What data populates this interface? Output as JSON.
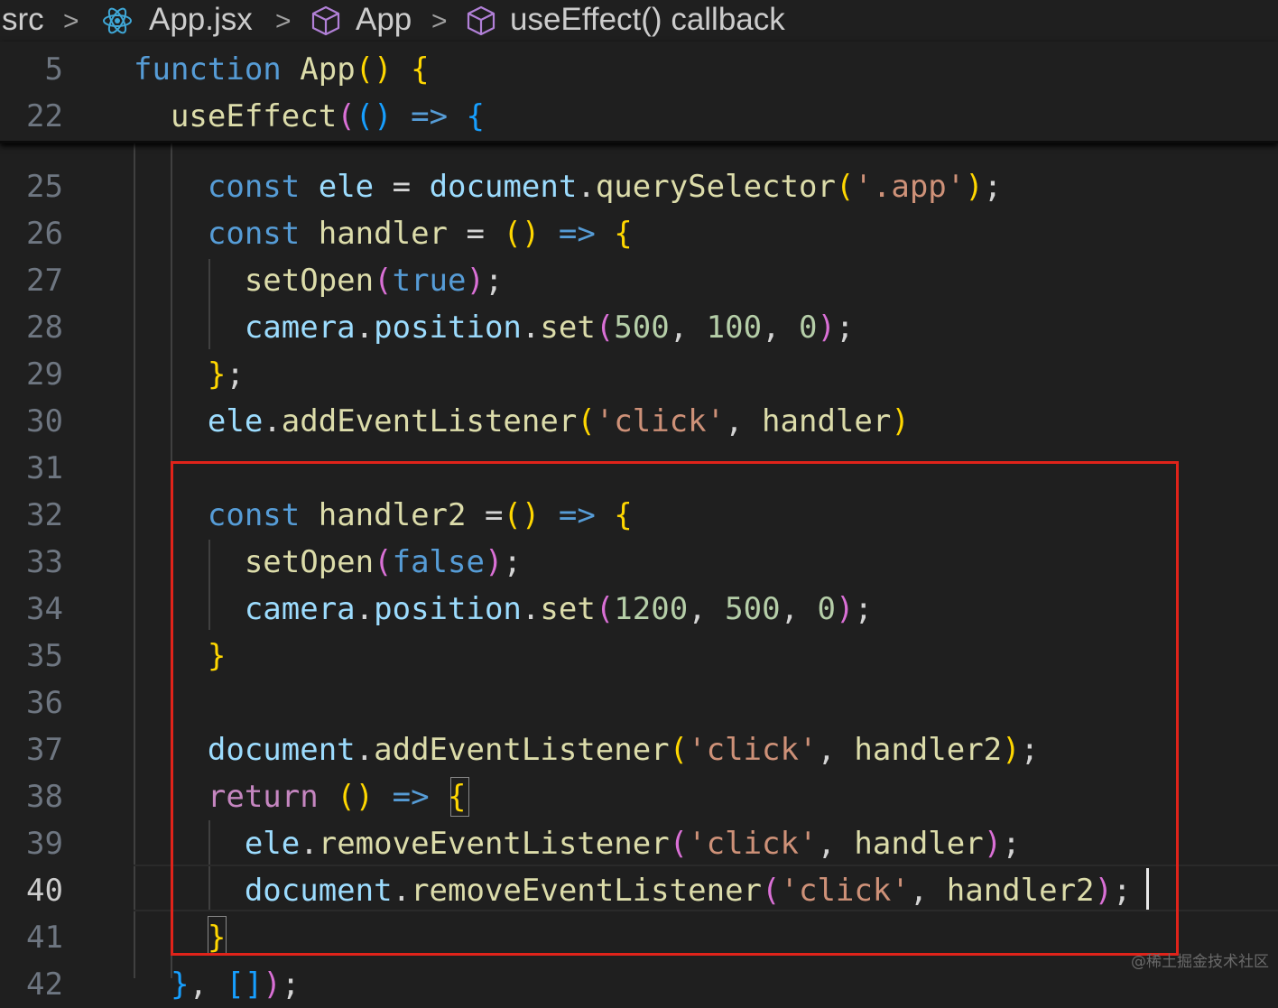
{
  "breadcrumb": {
    "items": [
      "src",
      "App.jsx",
      "App",
      "useEffect() callback"
    ],
    "separator": ">",
    "icons": [
      "react-icon",
      "cube-icon",
      "cube-icon"
    ]
  },
  "sticky_lines": [
    {
      "num": "5",
      "tokens": [
        {
          "t": "function",
          "c": "kw"
        },
        {
          "t": " ",
          "c": "pl"
        },
        {
          "t": "App",
          "c": "fn"
        },
        {
          "t": "()",
          "c": "b1"
        },
        {
          "t": " ",
          "c": "pl"
        },
        {
          "t": "{",
          "c": "b1"
        }
      ]
    },
    {
      "num": "22",
      "tokens": [
        {
          "t": "  ",
          "c": "pl"
        },
        {
          "t": "useEffect",
          "c": "fn"
        },
        {
          "t": "(",
          "c": "b2"
        },
        {
          "t": "()",
          "c": "b3"
        },
        {
          "t": " => ",
          "c": "kw"
        },
        {
          "t": "{",
          "c": "b3"
        }
      ]
    }
  ],
  "lines": [
    {
      "num": "25",
      "tokens": [
        {
          "t": "    ",
          "c": "pl"
        },
        {
          "t": "const",
          "c": "kw"
        },
        {
          "t": " ",
          "c": "pl"
        },
        {
          "t": "ele",
          "c": "var"
        },
        {
          "t": " = ",
          "c": "pl"
        },
        {
          "t": "document",
          "c": "var"
        },
        {
          "t": ".",
          "c": "pl"
        },
        {
          "t": "querySelector",
          "c": "fn"
        },
        {
          "t": "(",
          "c": "b1"
        },
        {
          "t": "'.app'",
          "c": "str"
        },
        {
          "t": ")",
          "c": "b1"
        },
        {
          "t": ";",
          "c": "pl"
        }
      ]
    },
    {
      "num": "26",
      "tokens": [
        {
          "t": "    ",
          "c": "pl"
        },
        {
          "t": "const",
          "c": "kw"
        },
        {
          "t": " ",
          "c": "pl"
        },
        {
          "t": "handler",
          "c": "fn"
        },
        {
          "t": " = ",
          "c": "pl"
        },
        {
          "t": "()",
          "c": "b1"
        },
        {
          "t": " => ",
          "c": "kw"
        },
        {
          "t": "{",
          "c": "b1"
        }
      ]
    },
    {
      "num": "27",
      "tokens": [
        {
          "t": "      ",
          "c": "pl"
        },
        {
          "t": "setOpen",
          "c": "fn"
        },
        {
          "t": "(",
          "c": "b2"
        },
        {
          "t": "true",
          "c": "kw"
        },
        {
          "t": ")",
          "c": "b2"
        },
        {
          "t": ";",
          "c": "pl"
        }
      ]
    },
    {
      "num": "28",
      "tokens": [
        {
          "t": "      ",
          "c": "pl"
        },
        {
          "t": "camera",
          "c": "var"
        },
        {
          "t": ".",
          "c": "pl"
        },
        {
          "t": "position",
          "c": "var"
        },
        {
          "t": ".",
          "c": "pl"
        },
        {
          "t": "set",
          "c": "fn"
        },
        {
          "t": "(",
          "c": "b2"
        },
        {
          "t": "500",
          "c": "num"
        },
        {
          "t": ", ",
          "c": "pl"
        },
        {
          "t": "100",
          "c": "num"
        },
        {
          "t": ", ",
          "c": "pl"
        },
        {
          "t": "0",
          "c": "num"
        },
        {
          "t": ")",
          "c": "b2"
        },
        {
          "t": ";",
          "c": "pl"
        }
      ]
    },
    {
      "num": "29",
      "tokens": [
        {
          "t": "    ",
          "c": "pl"
        },
        {
          "t": "}",
          "c": "b1"
        },
        {
          "t": ";",
          "c": "pl"
        }
      ]
    },
    {
      "num": "30",
      "tokens": [
        {
          "t": "    ",
          "c": "pl"
        },
        {
          "t": "ele",
          "c": "var"
        },
        {
          "t": ".",
          "c": "pl"
        },
        {
          "t": "addEventListener",
          "c": "fn"
        },
        {
          "t": "(",
          "c": "b1"
        },
        {
          "t": "'click'",
          "c": "str"
        },
        {
          "t": ", ",
          "c": "pl"
        },
        {
          "t": "handler",
          "c": "fn"
        },
        {
          "t": ")",
          "c": "b1"
        }
      ]
    },
    {
      "num": "31",
      "tokens": []
    },
    {
      "num": "32",
      "tokens": [
        {
          "t": "    ",
          "c": "pl"
        },
        {
          "t": "const",
          "c": "kw"
        },
        {
          "t": " ",
          "c": "pl"
        },
        {
          "t": "handler2",
          "c": "fn"
        },
        {
          "t": " =",
          "c": "pl"
        },
        {
          "t": "()",
          "c": "b1"
        },
        {
          "t": " => ",
          "c": "kw"
        },
        {
          "t": "{",
          "c": "b1"
        }
      ]
    },
    {
      "num": "33",
      "tokens": [
        {
          "t": "      ",
          "c": "pl"
        },
        {
          "t": "setOpen",
          "c": "fn"
        },
        {
          "t": "(",
          "c": "b2"
        },
        {
          "t": "false",
          "c": "kw"
        },
        {
          "t": ")",
          "c": "b2"
        },
        {
          "t": ";",
          "c": "pl"
        }
      ]
    },
    {
      "num": "34",
      "tokens": [
        {
          "t": "      ",
          "c": "pl"
        },
        {
          "t": "camera",
          "c": "var"
        },
        {
          "t": ".",
          "c": "pl"
        },
        {
          "t": "position",
          "c": "var"
        },
        {
          "t": ".",
          "c": "pl"
        },
        {
          "t": "set",
          "c": "fn"
        },
        {
          "t": "(",
          "c": "b2"
        },
        {
          "t": "1200",
          "c": "num"
        },
        {
          "t": ", ",
          "c": "pl"
        },
        {
          "t": "500",
          "c": "num"
        },
        {
          "t": ", ",
          "c": "pl"
        },
        {
          "t": "0",
          "c": "num"
        },
        {
          "t": ")",
          "c": "b2"
        },
        {
          "t": ";",
          "c": "pl"
        }
      ]
    },
    {
      "num": "35",
      "tokens": [
        {
          "t": "    ",
          "c": "pl"
        },
        {
          "t": "}",
          "c": "b1"
        }
      ]
    },
    {
      "num": "36",
      "tokens": []
    },
    {
      "num": "37",
      "tokens": [
        {
          "t": "    ",
          "c": "pl"
        },
        {
          "t": "document",
          "c": "var"
        },
        {
          "t": ".",
          "c": "pl"
        },
        {
          "t": "addEventListener",
          "c": "fn"
        },
        {
          "t": "(",
          "c": "b1"
        },
        {
          "t": "'click'",
          "c": "str"
        },
        {
          "t": ", ",
          "c": "pl"
        },
        {
          "t": "handler2",
          "c": "fn"
        },
        {
          "t": ")",
          "c": "b1"
        },
        {
          "t": ";",
          "c": "pl"
        }
      ]
    },
    {
      "num": "38",
      "tokens": [
        {
          "t": "    ",
          "c": "pl"
        },
        {
          "t": "return",
          "c": "ctl"
        },
        {
          "t": " ",
          "c": "pl"
        },
        {
          "t": "()",
          "c": "b1"
        },
        {
          "t": " => ",
          "c": "kw"
        },
        {
          "t": "{",
          "c": "b1"
        }
      ]
    },
    {
      "num": "39",
      "tokens": [
        {
          "t": "      ",
          "c": "pl"
        },
        {
          "t": "ele",
          "c": "var"
        },
        {
          "t": ".",
          "c": "pl"
        },
        {
          "t": "removeEventListener",
          "c": "fn"
        },
        {
          "t": "(",
          "c": "b2"
        },
        {
          "t": "'click'",
          "c": "str"
        },
        {
          "t": ", ",
          "c": "pl"
        },
        {
          "t": "handler",
          "c": "fn"
        },
        {
          "t": ")",
          "c": "b2"
        },
        {
          "t": ";",
          "c": "pl"
        }
      ]
    },
    {
      "num": "40",
      "active": true,
      "tokens": [
        {
          "t": "      ",
          "c": "pl"
        },
        {
          "t": "document",
          "c": "var"
        },
        {
          "t": ".",
          "c": "pl"
        },
        {
          "t": "removeEventListener",
          "c": "fn"
        },
        {
          "t": "(",
          "c": "b2"
        },
        {
          "t": "'click'",
          "c": "str"
        },
        {
          "t": ", ",
          "c": "pl"
        },
        {
          "t": "handler2",
          "c": "fn"
        },
        {
          "t": ")",
          "c": "b2"
        },
        {
          "t": ";",
          "c": "pl"
        }
      ]
    },
    {
      "num": "41",
      "tokens": [
        {
          "t": "    ",
          "c": "pl"
        },
        {
          "t": "}",
          "c": "b1"
        }
      ]
    },
    {
      "num": "42",
      "tokens": [
        {
          "t": "  ",
          "c": "pl"
        },
        {
          "t": "}",
          "c": "b3"
        },
        {
          "t": ", ",
          "c": "pl"
        },
        {
          "t": "[]",
          "c": "b3"
        },
        {
          "t": ")",
          "c": "b2"
        },
        {
          "t": ";",
          "c": "pl"
        }
      ]
    }
  ],
  "watermark": "@稀土掘金技术社区"
}
